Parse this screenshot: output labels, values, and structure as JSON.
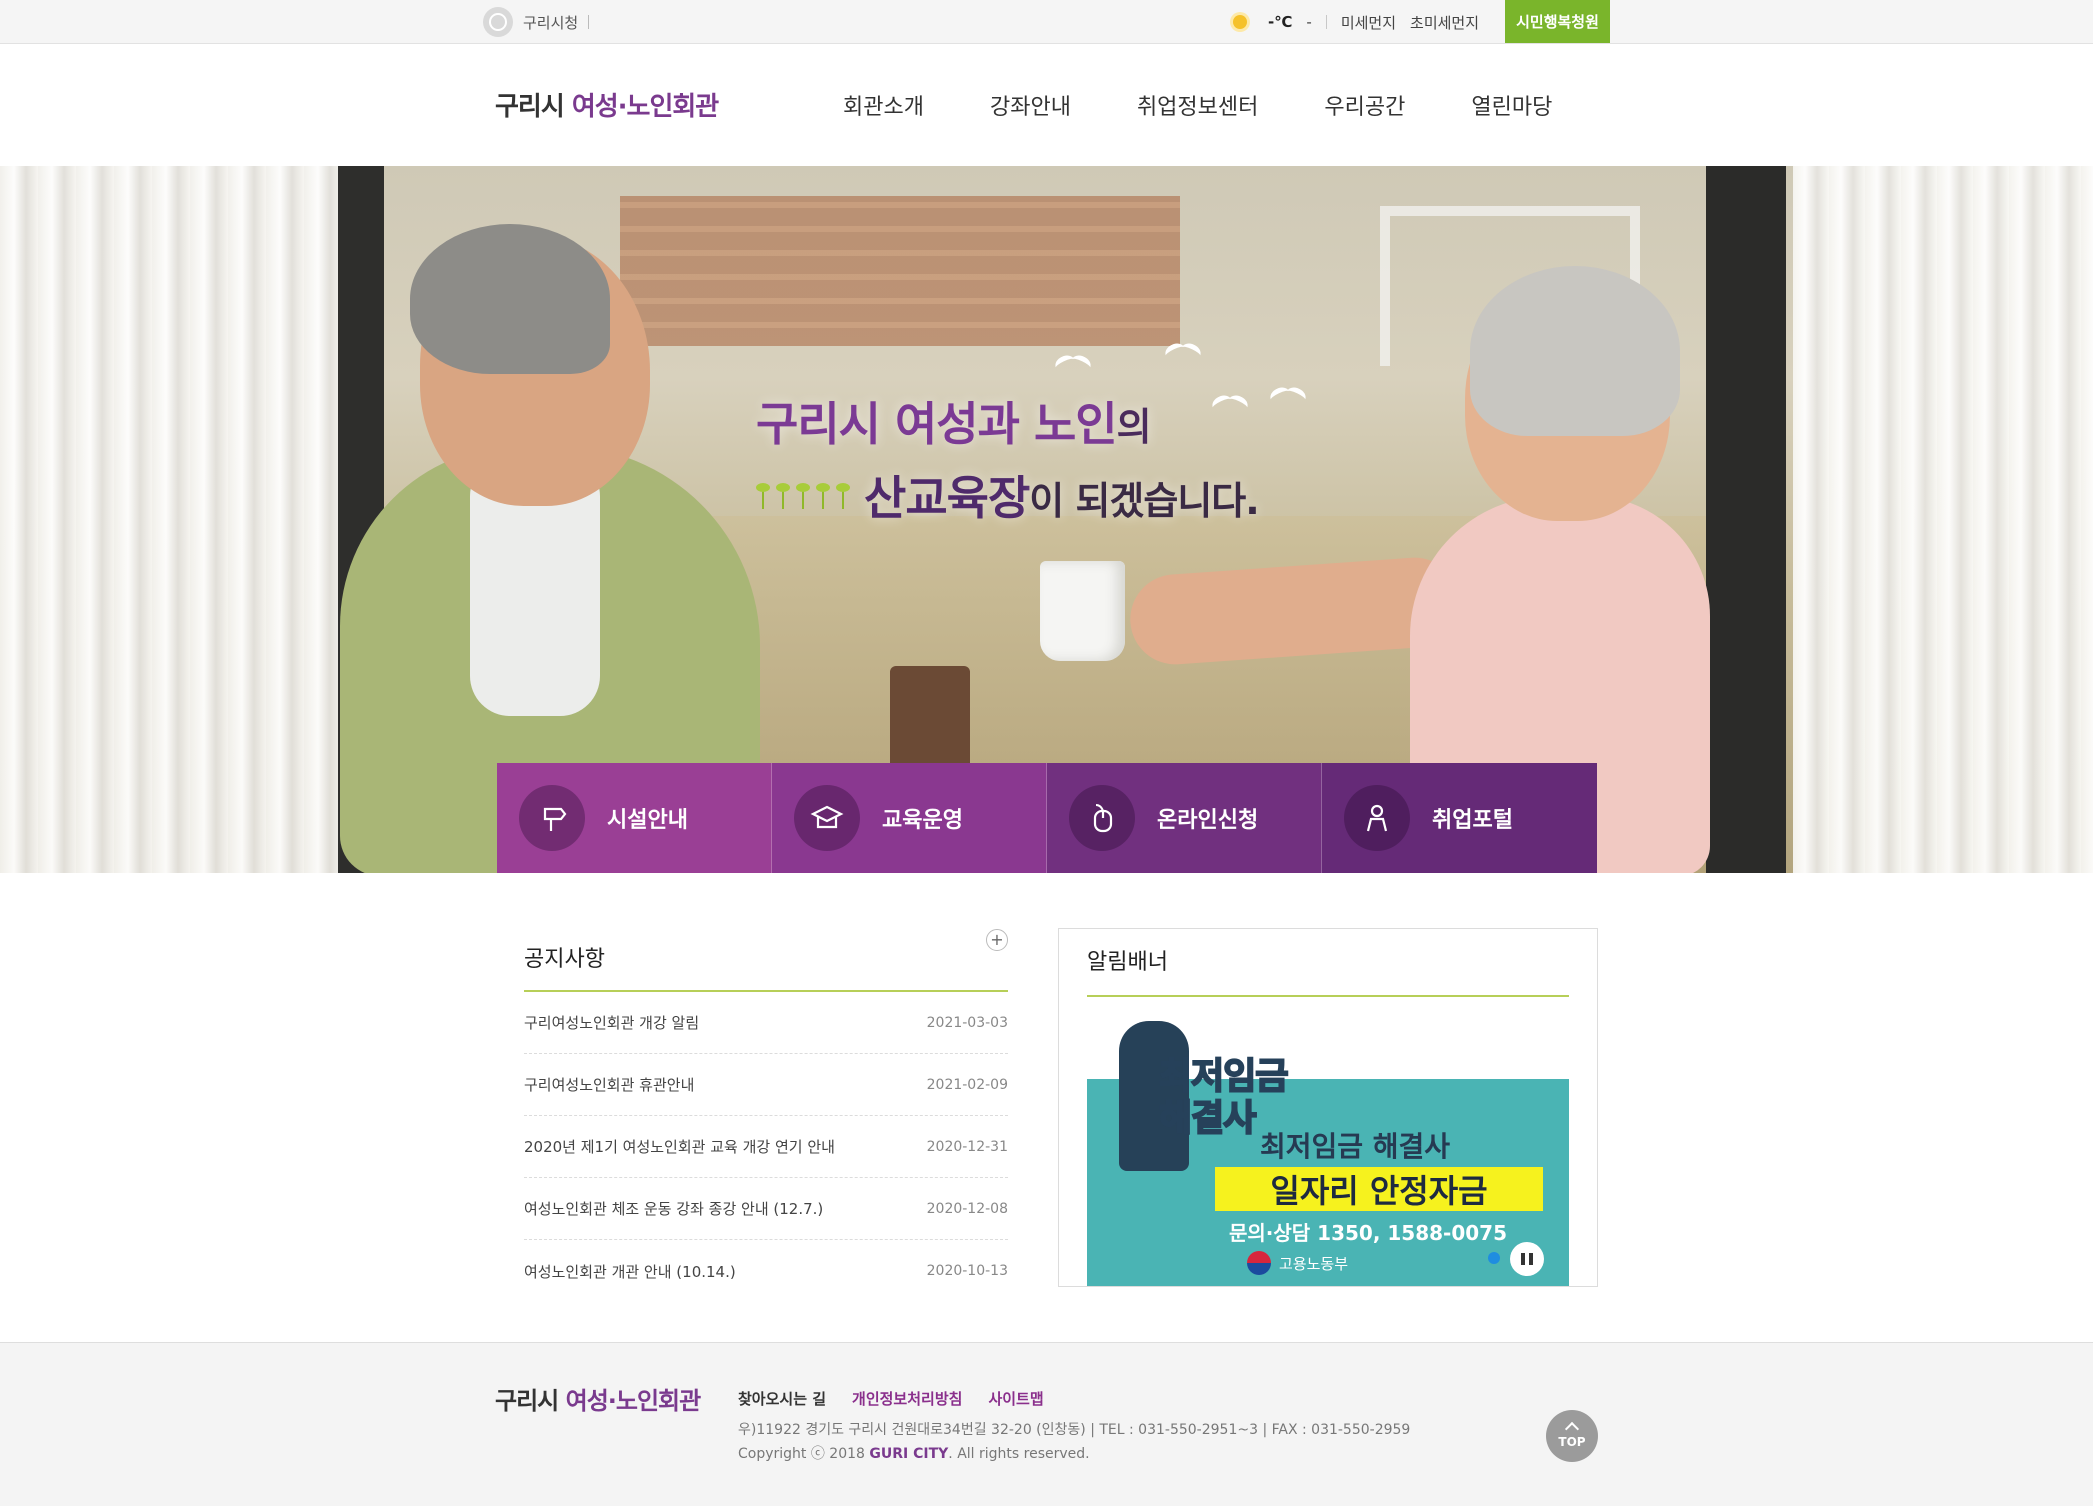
{
  "topbar": {
    "city_hall": "구리시청",
    "temperature": "-℃",
    "temp_suffix": "-",
    "fine_dust": "미세먼지",
    "ultrafine_dust": "초미세먼지",
    "happy_button": "시민행복청원",
    "happy_color": "#7ab52b"
  },
  "header": {
    "logo_prefix": "구리시 ",
    "logo_accent": "여성·노인회관",
    "nav": [
      "회관소개",
      "강좌안내",
      "취업정보센터",
      "우리공간",
      "열린마당"
    ]
  },
  "hero": {
    "line1_accent": "구리시 여성과 노인",
    "line1_tail": "의",
    "line2_strong": "산교육장",
    "line2_rest": "이 되겠습니다."
  },
  "quick_menu": [
    {
      "label": "시설안내",
      "icon": "signpost-icon"
    },
    {
      "label": "교육운영",
      "icon": "graduation-cap-icon"
    },
    {
      "label": "온라인신청",
      "icon": "mouse-icon"
    },
    {
      "label": "취업포털",
      "icon": "person-icon"
    }
  ],
  "notice": {
    "title": "공지사항",
    "more": "+",
    "items": [
      {
        "title": "구리여성노인회관 개강 알림",
        "date": "2021-03-03"
      },
      {
        "title": "구리여성노인회관 휴관안내",
        "date": "2021-02-09"
      },
      {
        "title": "2020년 제1기 여성노인회관 교육 개강 연기 안내",
        "date": "2020-12-31"
      },
      {
        "title": "여성노인회관 체조 운동 강좌 종강 안내 (12.7.)",
        "date": "2020-12-08"
      },
      {
        "title": "여성노인회관 개관 안내 (10.14.)",
        "date": "2020-10-13"
      }
    ]
  },
  "banner": {
    "title": "알림배너",
    "head1": "최저임금",
    "head2": "해결사",
    "sub": "최저임금 해결사",
    "highlight": "일자리 안정자금",
    "contact": "문의·상담 1350, 1588-0075",
    "ministry": "고용노동부"
  },
  "footer": {
    "logo_prefix": "구리시 ",
    "logo_accent": "여성·노인회관",
    "links": [
      "찾아오시는 길",
      "개인정보처리방침",
      "사이트맵"
    ],
    "address": "우)11922 경기도 구리시 건원대로34번길 32-20 (인창동)  |  TEL : 031-550-2951~3  |  FAX : 031-550-2959",
    "copyright_prefix": "Copyright ⓒ 2018 ",
    "copyright_city": "GURI CITY",
    "copyright_suffix": ". All rights reserved.",
    "top_button": "TOP"
  },
  "colors": {
    "brand_purple": "#7a3a8e",
    "accent_green": "#b7cf58"
  }
}
